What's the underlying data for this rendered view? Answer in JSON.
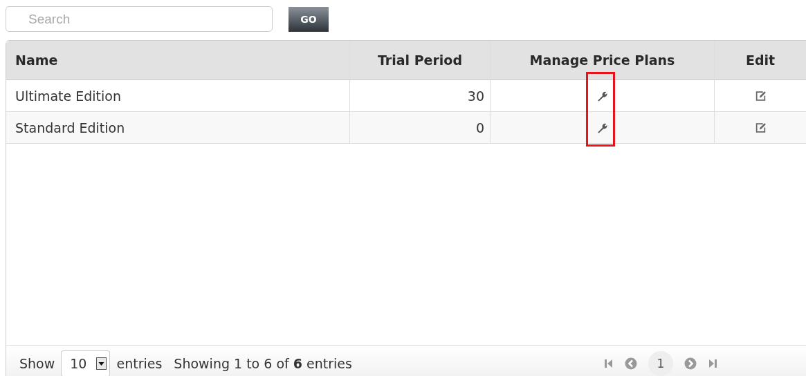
{
  "search": {
    "placeholder": "Search",
    "button": "GO"
  },
  "table": {
    "columns": [
      "Name",
      "Trial Period",
      "Manage Price Plans",
      "Edit"
    ],
    "rows": [
      {
        "name": "Ultimate Edition",
        "trial_period": "30"
      },
      {
        "name": "Standard Edition",
        "trial_period": "0"
      }
    ]
  },
  "footer": {
    "show_label": "Show",
    "page_size": "10",
    "entries_label": "entries",
    "info": "Showing 1 to 6 of **6** entries",
    "current_page": "1"
  }
}
